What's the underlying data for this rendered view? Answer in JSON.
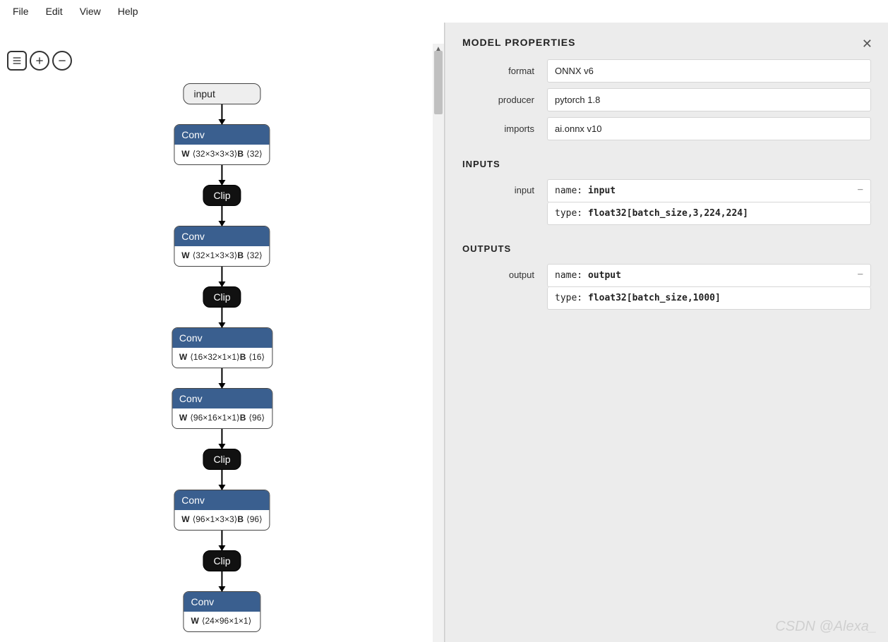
{
  "menu": {
    "items": [
      "File",
      "Edit",
      "View",
      "Help"
    ]
  },
  "toolbar": {
    "buttons": [
      "list",
      "zoom-in",
      "zoom-out"
    ]
  },
  "graph": {
    "input_label": "input",
    "nodes": [
      {
        "type": "conv",
        "title": "Conv",
        "w": "⟨32×3×3×3⟩",
        "b": "⟨32⟩"
      },
      {
        "type": "clip",
        "title": "Clip"
      },
      {
        "type": "conv",
        "title": "Conv",
        "w": "⟨32×1×3×3⟩",
        "b": "⟨32⟩"
      },
      {
        "type": "clip",
        "title": "Clip"
      },
      {
        "type": "conv",
        "title": "Conv",
        "w": "⟨16×32×1×1⟩",
        "b": "⟨16⟩"
      },
      {
        "type": "conv",
        "title": "Conv",
        "w": "⟨96×16×1×1⟩",
        "b": "⟨96⟩"
      },
      {
        "type": "clip",
        "title": "Clip"
      },
      {
        "type": "conv",
        "title": "Conv",
        "w": "⟨96×1×3×3⟩",
        "b": "⟨96⟩"
      },
      {
        "type": "clip",
        "title": "Clip"
      },
      {
        "type": "conv",
        "title": "Conv",
        "w": "⟨24×96×1×1⟩",
        "b": ""
      }
    ]
  },
  "sidebar": {
    "title": "MODEL PROPERTIES",
    "props": {
      "format_label": "format",
      "format_value": "ONNX v6",
      "producer_label": "producer",
      "producer_value": "pytorch 1.8",
      "imports_label": "imports",
      "imports_value": "ai.onnx v10"
    },
    "inputs_title": "INPUTS",
    "inputs": {
      "label": "input",
      "name_key": "name:",
      "name_val": "input",
      "type_key": "type:",
      "type_val": "float32[batch_size,3,224,224]"
    },
    "outputs_title": "OUTPUTS",
    "outputs": {
      "label": "output",
      "name_key": "name:",
      "name_val": "output",
      "type_key": "type:",
      "type_val": "float32[batch_size,1000]"
    }
  },
  "watermark": "CSDN @Alexa_"
}
